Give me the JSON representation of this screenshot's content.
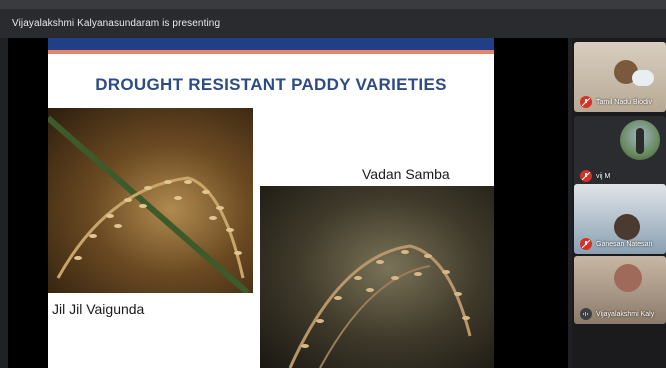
{
  "presenter_banner": "Vijayalakshmi Kalyanasundaram is presenting",
  "slide": {
    "title": "DROUGHT RESISTANT PADDY VARIETIES",
    "varieties": [
      "Vadan Samba",
      "Jil Jil Vaigunda"
    ]
  },
  "participants": [
    {
      "name": "Tamil Nadu Biodiv",
      "mic": "muted"
    },
    {
      "name": "vij M",
      "mic": "muted"
    },
    {
      "name": "Ganesan Natesan",
      "mic": "muted"
    },
    {
      "name": "Vijayalakshmi Kaly",
      "mic": "on"
    }
  ],
  "colors": {
    "slide_title": "#2d4b86",
    "slide_band_blue": "#1f3f86",
    "slide_band_orange": "#e8826b",
    "mic_muted": "#d93025"
  }
}
